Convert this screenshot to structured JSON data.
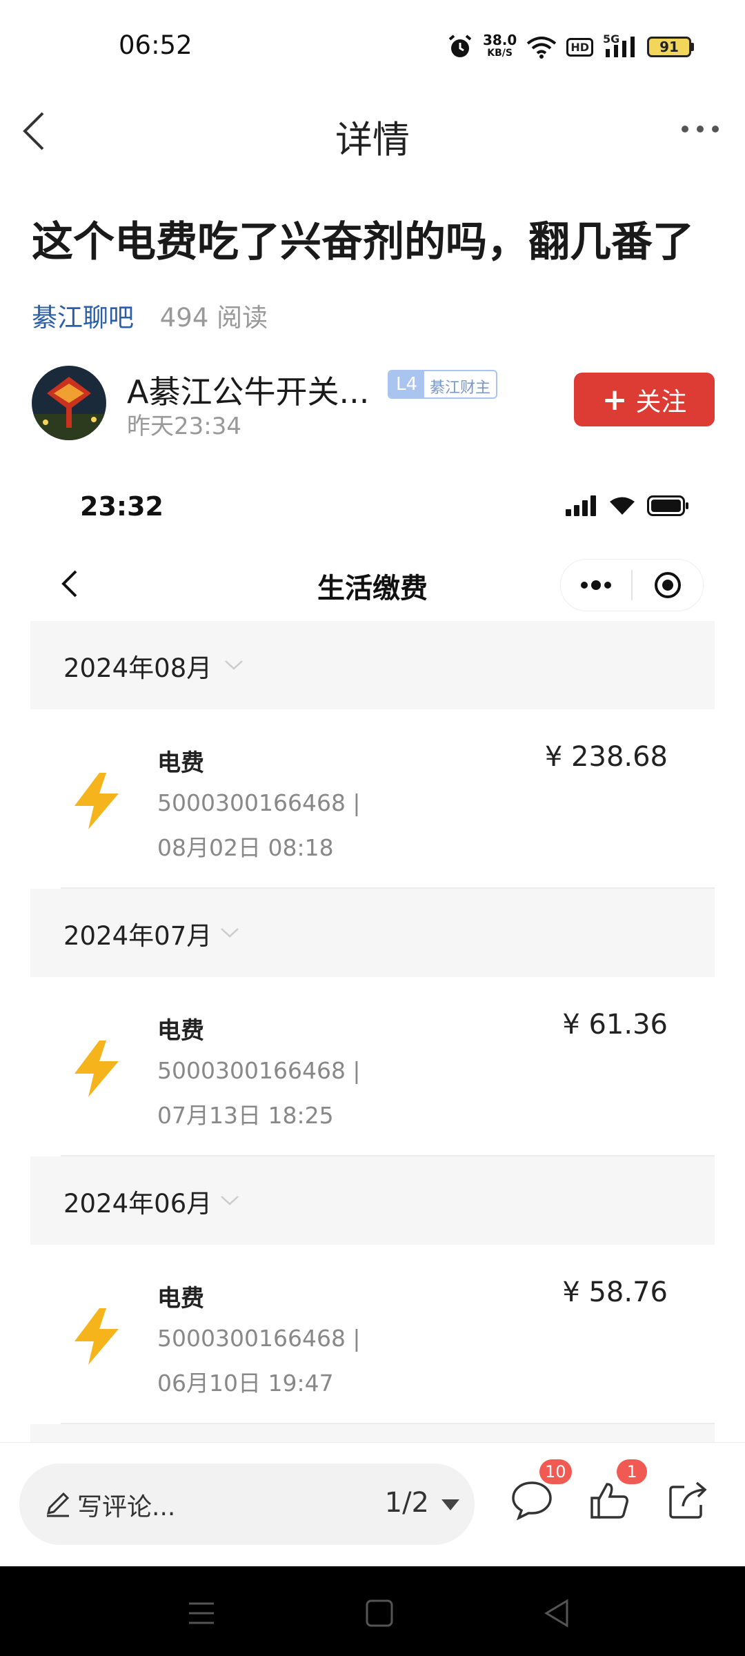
{
  "status_bar": {
    "time": "06:52",
    "net_speed_value": "38.0",
    "net_speed_unit": "KB/S",
    "hd": "HD",
    "network": "5G",
    "battery": "91"
  },
  "nav": {
    "title": "详情"
  },
  "post": {
    "title": "这个电费吃了兴奋剂的吗，翻几番了",
    "forum": "綦江聊吧",
    "reads": "494 阅读"
  },
  "author": {
    "name": "A綦江公牛开关...",
    "level": "L4",
    "rank": "綦江财主",
    "time": "昨天23:34",
    "follow_label": "关注"
  },
  "embedded": {
    "time": "23:32",
    "title": "生活缴费",
    "groups": [
      {
        "month": "2024年08月",
        "bill": {
          "name": "电费",
          "amount": "¥ 238.68",
          "account": "5000300166468 |",
          "date": "08月02日 08:18"
        }
      },
      {
        "month": "2024年07月",
        "bill": {
          "name": "电费",
          "amount": "¥ 61.36",
          "account": "5000300166468 |",
          "date": "07月13日 18:25"
        }
      },
      {
        "month": "2024年06月",
        "bill": {
          "name": "电费",
          "amount": "¥ 58.76",
          "account": "5000300166468 |",
          "date": "06月10日 19:47"
        }
      }
    ]
  },
  "bottom_bar": {
    "comment_placeholder": "写评论...",
    "page_indicator": "1/2",
    "comment_count": "10",
    "like_count": "1"
  },
  "colors": {
    "accent_red": "#dd3c34",
    "forum_blue": "#2a5ea8",
    "bolt_yellow": "#f6b41c"
  }
}
